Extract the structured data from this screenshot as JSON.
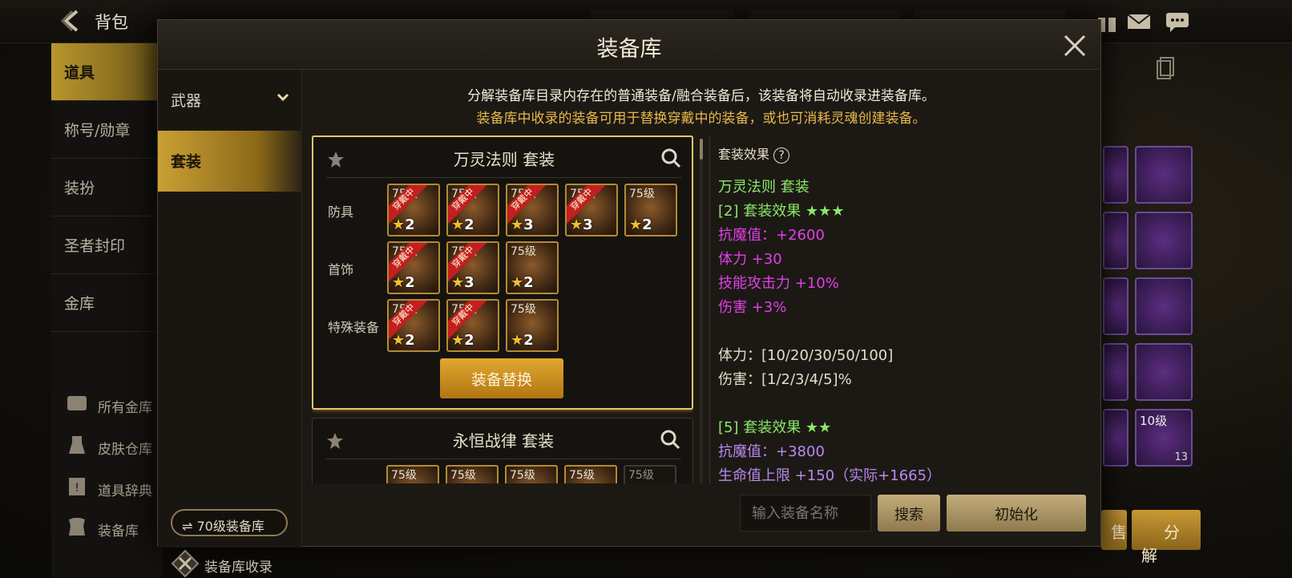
{
  "topbar": {
    "title": "背包"
  },
  "left_menu": {
    "items": [
      {
        "label": "道具"
      },
      {
        "label": "称号/勋章"
      },
      {
        "label": "装扮"
      },
      {
        "label": "圣者封印"
      },
      {
        "label": "金库"
      }
    ],
    "sub": [
      {
        "label": "所有金库",
        "icon": "vault-icon"
      },
      {
        "label": "皮肤仓库",
        "icon": "skin-icon"
      },
      {
        "label": "道具辞典",
        "icon": "book-icon"
      },
      {
        "label": "装备库",
        "icon": "armor-icon"
      }
    ]
  },
  "behind": {
    "slot_level": "10级",
    "slot_count": "13",
    "sell_label": "售",
    "decompose_label": "分解"
  },
  "modal": {
    "title": "装备库",
    "sidebar": {
      "categories": [
        {
          "label": "武器"
        },
        {
          "label": "套装"
        }
      ],
      "lib_switch": "⇌ 70级装备库",
      "lib_collect": "装备库收录"
    },
    "info_line1": "分解装备库目录内存在的普通装备/融合装备后，该装备将自动收录进装备库。",
    "info_line2": "装备库中收录的装备可用于替换穿戴中的装备，或也可消耗灵魂创建装备。",
    "sets": [
      {
        "name": "万灵法则  套装",
        "rows": [
          {
            "label": "防具",
            "slots": [
              {
                "lvl": "75级",
                "worn": true,
                "stars": "2"
              },
              {
                "lvl": "75级",
                "worn": true,
                "stars": "2"
              },
              {
                "lvl": "75级",
                "worn": true,
                "stars": "3"
              },
              {
                "lvl": "75级",
                "worn": true,
                "stars": "3"
              },
              {
                "lvl": "75级",
                "worn": false,
                "stars": "2"
              }
            ]
          },
          {
            "label": "首饰",
            "slots": [
              {
                "lvl": "75级",
                "worn": true,
                "stars": "2"
              },
              {
                "lvl": "75级",
                "worn": true,
                "stars": "3"
              },
              {
                "lvl": "75级",
                "worn": false,
                "stars": "2"
              }
            ]
          },
          {
            "label": "特殊装备",
            "slots": [
              {
                "lvl": "75级",
                "worn": true,
                "stars": "2"
              },
              {
                "lvl": "75级",
                "worn": true,
                "stars": "2"
              },
              {
                "lvl": "75级",
                "worn": false,
                "stars": "2"
              }
            ]
          }
        ],
        "replace_label": "装备替换"
      },
      {
        "name": "永恒战律  套装",
        "slots": [
          "75级",
          "75级",
          "75级",
          "75级",
          "75级"
        ]
      }
    ],
    "ribbon_text": "穿戴中",
    "effect": {
      "heading": "套装效果",
      "help": "?",
      "lines": [
        {
          "text": "万灵法则  套装",
          "color": "g"
        },
        {
          "text": "[2] 套装效果 ★★★",
          "color": "g"
        },
        {
          "text": "抗魔值：+2600",
          "color": "p"
        },
        {
          "text": "体力 +30",
          "color": "p"
        },
        {
          "text": "技能攻击力 +10%",
          "color": "p"
        },
        {
          "text": "伤害 +3%",
          "color": "p"
        },
        {
          "text": "",
          "color": "w"
        },
        {
          "text": "体力：[10/20/30/50/100]",
          "color": "w"
        },
        {
          "text": "伤害：[1/2/3/4/5]%",
          "color": "w"
        },
        {
          "text": "",
          "color": "w"
        },
        {
          "text": "[5] 套装效果 ★★",
          "color": "g"
        },
        {
          "text": "抗魔值：+3800",
          "color": "v"
        },
        {
          "text": "生命值上限 +150（实际+1665）",
          "color": "v"
        }
      ]
    },
    "footer": {
      "search_placeholder": "输入装备名称",
      "search_label": "搜索",
      "reset_label": "初始化"
    }
  }
}
